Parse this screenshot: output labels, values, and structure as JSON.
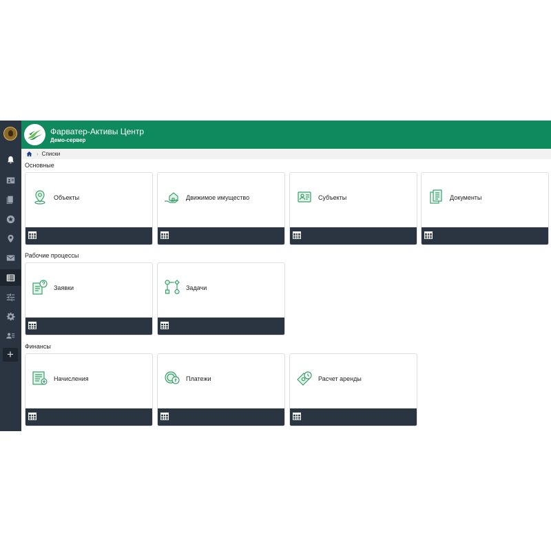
{
  "app": {
    "title": "Фарватер-Активы Центр",
    "subtitle": "Демо-сервер",
    "accent_color": "#0f8a5f",
    "sidebar_color": "#2b3542"
  },
  "sidebar": {
    "items": [
      {
        "icon": "bell-icon"
      },
      {
        "icon": "contact-card-icon"
      },
      {
        "icon": "documents-icon"
      },
      {
        "icon": "star-icon"
      },
      {
        "icon": "location-pin-icon"
      },
      {
        "icon": "mail-icon"
      },
      {
        "icon": "list-icon",
        "active": true
      },
      {
        "icon": "sliders-icon"
      },
      {
        "icon": "gear-icon"
      },
      {
        "icon": "users-list-icon"
      }
    ],
    "add_label": "+"
  },
  "breadcrumb": {
    "home_icon": "home-icon",
    "current": "Списки"
  },
  "sections": [
    {
      "title": "Основные",
      "cards": [
        {
          "label": "Объекты",
          "icon": "location-marker-icon"
        },
        {
          "label": "Движимое имущество",
          "icon": "hand-house-icon"
        },
        {
          "label": "Субъекты",
          "icon": "person-card-icon"
        },
        {
          "label": "Документы",
          "icon": "documents-stack-icon"
        }
      ]
    },
    {
      "title": "Рабочие процессы",
      "cards": [
        {
          "label": "Заявки",
          "icon": "request-document-icon"
        },
        {
          "label": "Задачи",
          "icon": "workflow-icon"
        }
      ]
    },
    {
      "title": "Финансы",
      "cards": [
        {
          "label": "Начисления",
          "icon": "accrual-document-icon"
        },
        {
          "label": "Платежи",
          "icon": "coins-icon"
        },
        {
          "label": "Расчет аренды",
          "icon": "money-calculation-icon"
        }
      ]
    }
  ]
}
